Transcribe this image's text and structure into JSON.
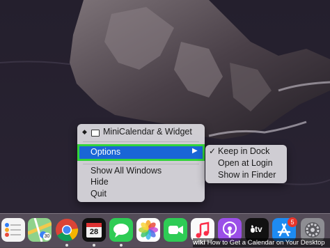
{
  "menu": {
    "app_title": "MiniCalendar & Widget",
    "options_label": "Options",
    "show_all_windows_label": "Show All Windows",
    "hide_label": "Hide",
    "quit_label": "Quit"
  },
  "submenu": {
    "keep_in_dock_label": "Keep in Dock",
    "keep_in_dock_checked": true,
    "open_at_login_label": "Open at Login",
    "show_in_finder_label": "Show in Finder"
  },
  "dock": {
    "calendar_day": "28",
    "calendar_badge_text": "30",
    "tv_label": "tv",
    "app_store_badge": "5",
    "icons": [
      "reminders-icon",
      "maps-icon",
      "chrome-icon",
      "minicalendar-icon",
      "messages-icon",
      "photos-icon",
      "facetime-icon",
      "music-icon",
      "podcasts-icon",
      "apple-tv-icon",
      "app-store-icon",
      "system-preferences-icon"
    ]
  },
  "colors": {
    "highlight": "#1966d6",
    "highlight_border": "#32d43a",
    "menu_bg": "#d6d4da"
  },
  "watermark": {
    "brand": "wiki",
    "title": "How to Get a Calendar on Your Desktop"
  }
}
